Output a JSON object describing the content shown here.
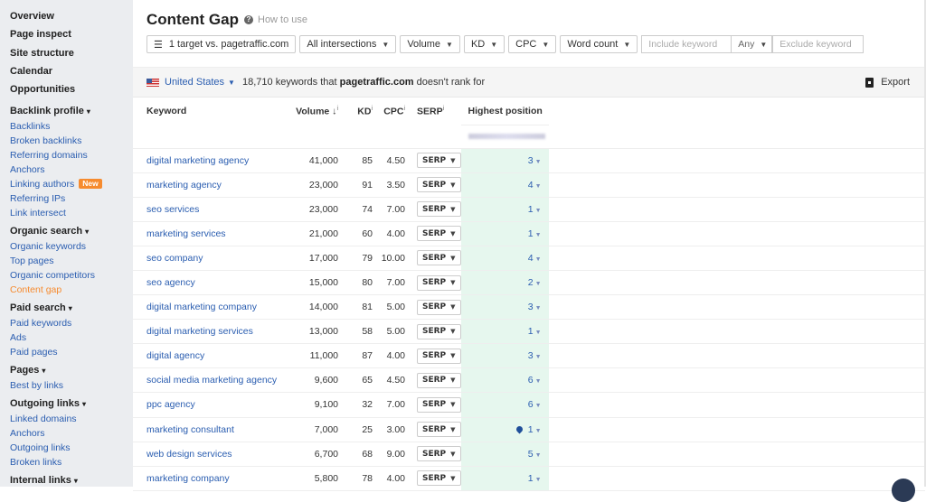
{
  "sidebar": {
    "top_items": [
      "Overview",
      "Page inspect",
      "Site structure",
      "Calendar",
      "Opportunities"
    ],
    "sections": [
      {
        "title": "Backlink profile",
        "links": [
          "Backlinks",
          "Broken backlinks",
          "Referring domains",
          "Anchors",
          "Linking authors",
          "Referring IPs",
          "Link intersect"
        ],
        "badge": {
          "index": 4,
          "label": "New"
        }
      },
      {
        "title": "Organic search",
        "links": [
          "Organic keywords",
          "Top pages",
          "Organic competitors",
          "Content gap"
        ],
        "active_index": 3
      },
      {
        "title": "Paid search",
        "links": [
          "Paid keywords",
          "Ads",
          "Paid pages"
        ]
      },
      {
        "title": "Pages",
        "links": [
          "Best by links"
        ]
      },
      {
        "title": "Outgoing links",
        "links": [
          "Linked domains",
          "Anchors",
          "Outgoing links",
          "Broken links"
        ]
      },
      {
        "title": "Internal links",
        "links": []
      }
    ],
    "caret": "▾"
  },
  "header": {
    "title": "Content Gap",
    "help_icon": "?",
    "how_to": "How to use"
  },
  "filters": {
    "target": "1 target vs. pagetraffic.com",
    "intersections": "All intersections",
    "volume": "Volume",
    "kd": "KD",
    "cpc": "CPC",
    "word_count": "Word count",
    "include_placeholder": "Include keyword",
    "any": "Any",
    "exclude_placeholder": "Exclude keyword"
  },
  "strip": {
    "country": "United States",
    "count": "18,710",
    "text_pre": "keywords that",
    "domain": "pagetraffic.com",
    "text_post": "doesn't rank for",
    "export": "Export"
  },
  "table": {
    "headers": {
      "keyword": "Keyword",
      "volume": "Volume ↓",
      "kd": "KD",
      "cpc": "CPC",
      "serp": "SERP",
      "highest_position": "Highest position",
      "info": "i"
    },
    "serp_label": "SERP",
    "rows": [
      {
        "keyword": "digital marketing agency",
        "volume": "41,000",
        "kd": "85",
        "cpc": "4.50",
        "position": "3",
        "pin": false
      },
      {
        "keyword": "marketing agency",
        "volume": "23,000",
        "kd": "91",
        "cpc": "3.50",
        "position": "4",
        "pin": false
      },
      {
        "keyword": "seo services",
        "volume": "23,000",
        "kd": "74",
        "cpc": "7.00",
        "position": "1",
        "pin": false
      },
      {
        "keyword": "marketing services",
        "volume": "21,000",
        "kd": "60",
        "cpc": "4.00",
        "position": "1",
        "pin": false
      },
      {
        "keyword": "seo company",
        "volume": "17,000",
        "kd": "79",
        "cpc": "10.00",
        "position": "4",
        "pin": false
      },
      {
        "keyword": "seo agency",
        "volume": "15,000",
        "kd": "80",
        "cpc": "7.00",
        "position": "2",
        "pin": false
      },
      {
        "keyword": "digital marketing company",
        "volume": "14,000",
        "kd": "81",
        "cpc": "5.00",
        "position": "3",
        "pin": false
      },
      {
        "keyword": "digital marketing services",
        "volume": "13,000",
        "kd": "58",
        "cpc": "5.00",
        "position": "1",
        "pin": false
      },
      {
        "keyword": "digital agency",
        "volume": "11,000",
        "kd": "87",
        "cpc": "4.00",
        "position": "3",
        "pin": false
      },
      {
        "keyword": "social media marketing agency",
        "volume": "9,600",
        "kd": "65",
        "cpc": "4.50",
        "position": "6",
        "pin": false
      },
      {
        "keyword": "ppc agency",
        "volume": "9,100",
        "kd": "32",
        "cpc": "7.00",
        "position": "6",
        "pin": false
      },
      {
        "keyword": "marketing consultant",
        "volume": "7,000",
        "kd": "25",
        "cpc": "3.00",
        "position": "1",
        "pin": true
      },
      {
        "keyword": "web design services",
        "volume": "6,700",
        "kd": "68",
        "cpc": "9.00",
        "position": "5",
        "pin": false
      },
      {
        "keyword": "marketing company",
        "volume": "5,800",
        "kd": "78",
        "cpc": "4.00",
        "position": "1",
        "pin": false
      }
    ]
  }
}
